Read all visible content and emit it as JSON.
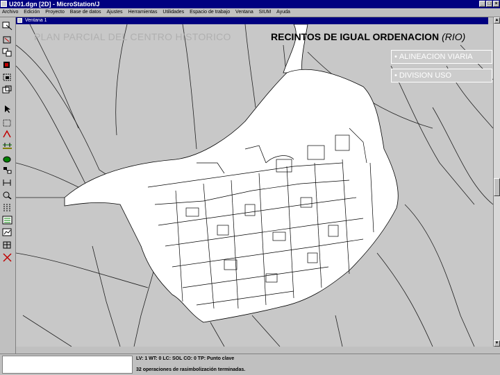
{
  "window": {
    "title": "U201.dgn [2D] - MicroStation/J"
  },
  "menubar": {
    "items": [
      {
        "label": "Archivo"
      },
      {
        "label": "Edición"
      },
      {
        "label": "Proyecto"
      },
      {
        "label": "Base de datos"
      },
      {
        "label": "Ajustes"
      },
      {
        "label": "Herramientas"
      },
      {
        "label": "Utilidades"
      },
      {
        "label": "Espacio de trabajo"
      },
      {
        "label": "Ventana"
      },
      {
        "label": "SIUM"
      },
      {
        "label": "Ayuda"
      }
    ]
  },
  "view": {
    "title": "Ventana 1"
  },
  "overlay": {
    "title": "PLAN PARCIAL DEL CENTRO HISTORICO"
  },
  "slide": {
    "title": "RECINTOS DE IGUAL ORDENACION",
    "subtitle": "(RIO)"
  },
  "legend": {
    "items": [
      {
        "bullet": "•",
        "label": "ALINEACION VIARIA"
      },
      {
        "bullet": "•",
        "label": "DIVISION USO"
      }
    ]
  },
  "status": {
    "attributes": "LV: 1 WT: 0 LC: SOL CO: 0 TP: Punto clave",
    "message": "32 operaciones de rasimbolización terminadas."
  },
  "toolbox": {
    "icons": [
      "place-line-icon",
      "place-block-icon",
      "copy-element-icon",
      "delete-element-icon",
      "fence-icon",
      "select-element-icon",
      "polygon-icon",
      "arc-icon",
      "dimension-icon",
      "fill-icon",
      "cell-icon",
      "measure-icon",
      "view-zoom-icon",
      "dashed-line-icon",
      "pattern-icon",
      "chart-icon",
      "close-x-icon"
    ]
  },
  "colors": {
    "titlebar": "#000080",
    "chrome": "#c0c0c0",
    "canvas": "#c8c8c8",
    "map_fill": "#ffffff"
  }
}
